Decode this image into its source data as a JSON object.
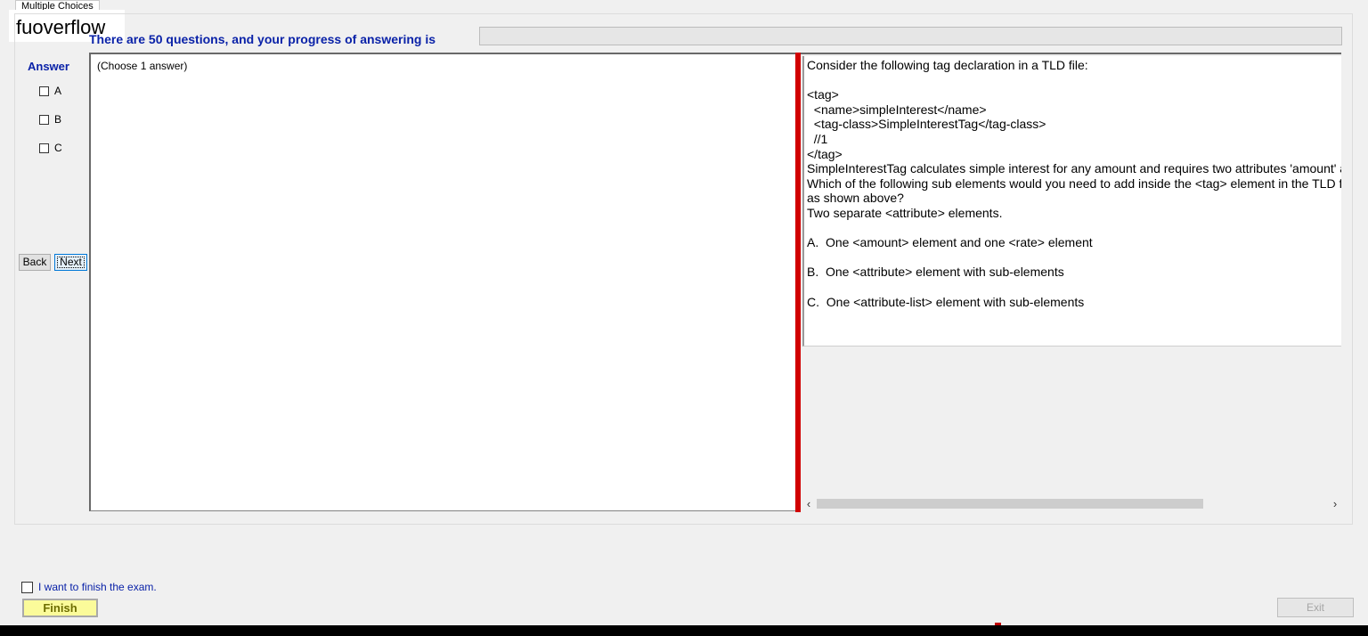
{
  "tab": {
    "label": "Multiple Choices"
  },
  "watermark": {
    "text": "fuoverflow"
  },
  "progress": {
    "label": "There are 50 questions, and your progress of answering is",
    "value_percent": 0
  },
  "answer": {
    "heading": "Answer",
    "options": [
      {
        "label": "A",
        "checked": false
      },
      {
        "label": "B",
        "checked": false
      },
      {
        "label": "C",
        "checked": false
      }
    ]
  },
  "nav": {
    "back_label": "Back",
    "next_label": "Next"
  },
  "left_panel": {
    "instruction": "(Choose 1 answer)"
  },
  "question": {
    "lines": [
      "Consider the following tag declaration in a TLD file:",
      "",
      "<tag>",
      "  <name>simpleInterest</name>",
      "  <tag-class>SimpleInterestTag</tag-class>",
      "  //1",
      "</tag>",
      "SimpleInterestTag calculates simple interest for any amount and requires two attributes 'amount' and 'rate'.",
      "Which of the following sub elements would you need to add inside the <tag> element in the TLD file",
      "as shown above?",
      "Two separate <attribute> elements.",
      "",
      "A.  One <amount> element and one <rate> element",
      "",
      "B.  One <attribute> element with sub-elements",
      "",
      "C.  One <attribute-list> element with sub-elements"
    ]
  },
  "footer": {
    "finish_check_label": "I want to finish the exam.",
    "finish_label": "Finish",
    "exit_label": "Exit"
  },
  "colors": {
    "accent": "#0a22a8",
    "divider": "#d10000",
    "finish_bg": "#fbfb9a"
  }
}
